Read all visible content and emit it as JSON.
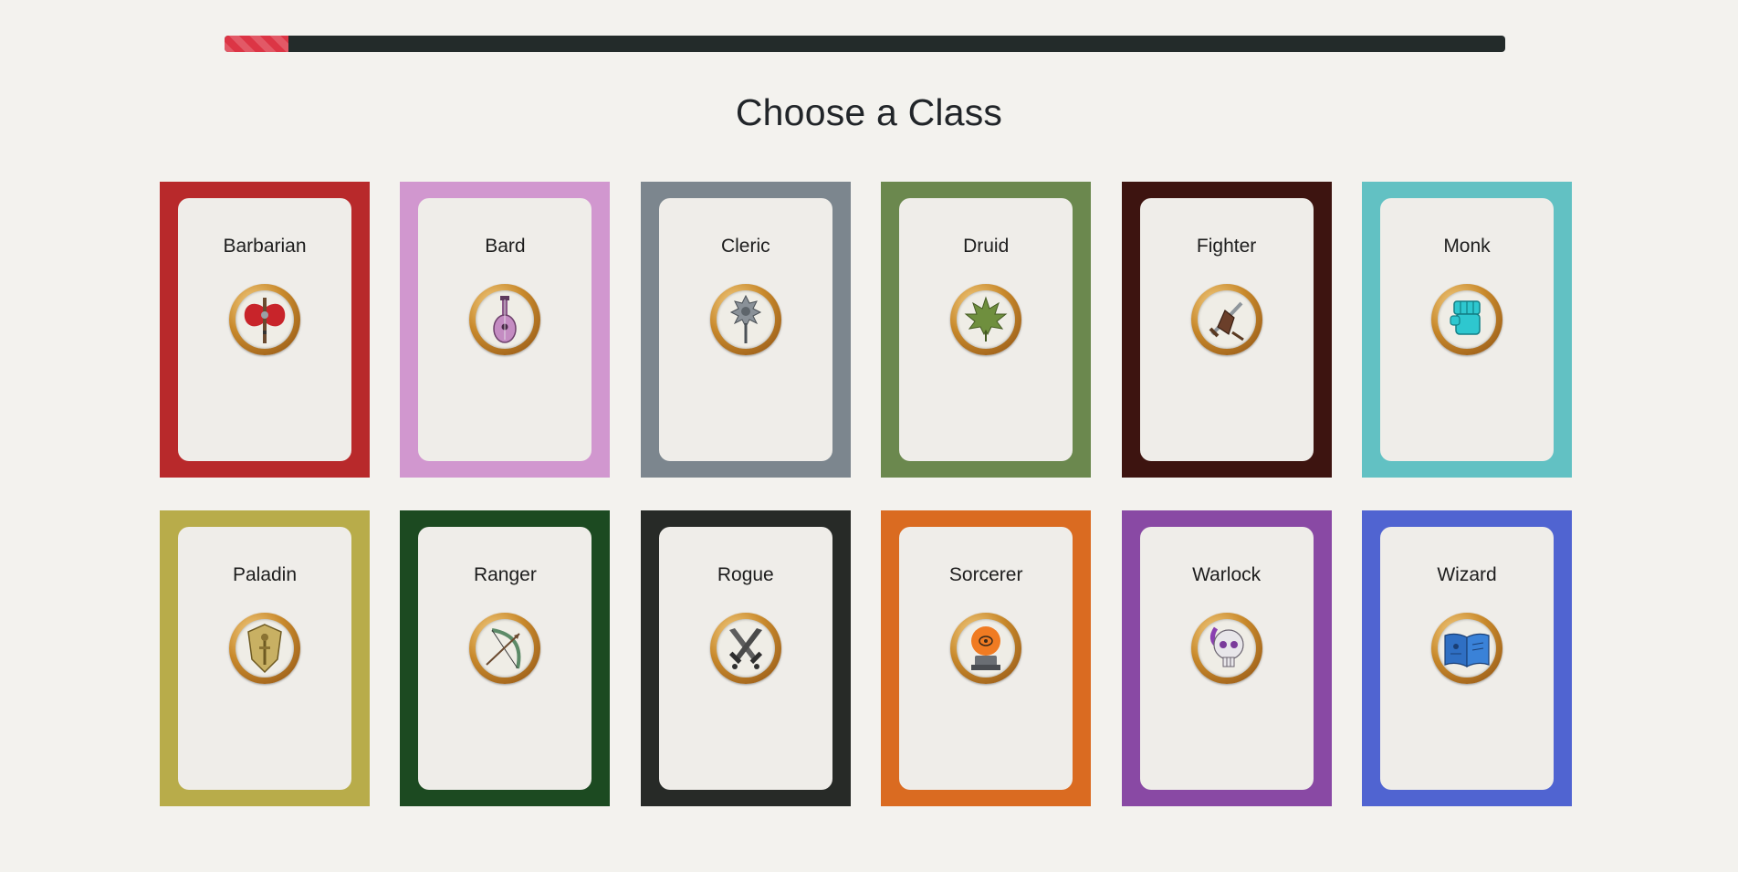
{
  "progress": {
    "value": 0.05,
    "color": "#dc3545"
  },
  "title": "Choose a Class",
  "classes": [
    {
      "name": "Barbarian",
      "color": "#b8292b",
      "icon": "double-axe-icon"
    },
    {
      "name": "Bard",
      "color": "#d197cf",
      "icon": "lute-icon"
    },
    {
      "name": "Cleric",
      "color": "#7c868e",
      "icon": "mace-icon"
    },
    {
      "name": "Druid",
      "color": "#6b884e",
      "icon": "leaf-icon"
    },
    {
      "name": "Fighter",
      "color": "#3d1410",
      "icon": "sword-shield-icon"
    },
    {
      "name": "Monk",
      "color": "#62c1c3",
      "icon": "fist-icon"
    },
    {
      "name": "Paladin",
      "color": "#b8ac4a",
      "icon": "shield-icon"
    },
    {
      "name": "Ranger",
      "color": "#1c4a21",
      "icon": "bow-arrow-icon"
    },
    {
      "name": "Rogue",
      "color": "#272a27",
      "icon": "crossed-daggers-icon"
    },
    {
      "name": "Sorcerer",
      "color": "#da6b21",
      "icon": "flame-orb-icon"
    },
    {
      "name": "Warlock",
      "color": "#8949a4",
      "icon": "skull-icon"
    },
    {
      "name": "Wizard",
      "color": "#5064d1",
      "icon": "spellbook-icon"
    }
  ]
}
